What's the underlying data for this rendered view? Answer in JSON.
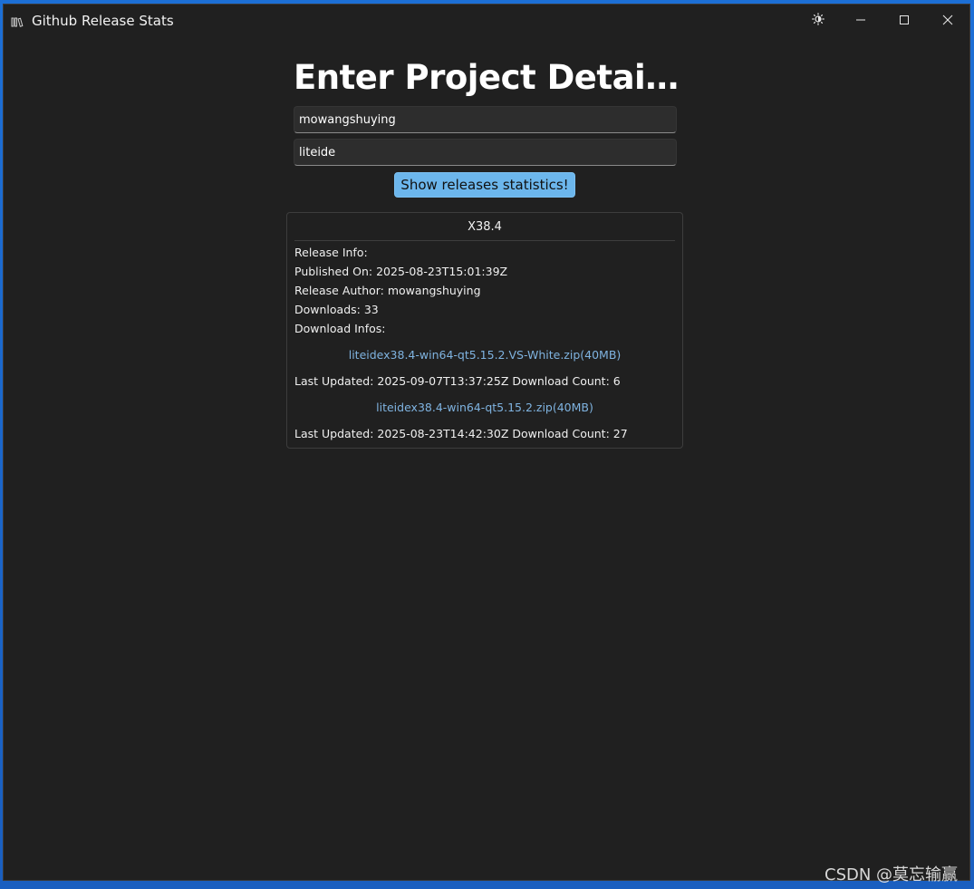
{
  "window": {
    "title": "Github Release Stats",
    "icon": "library-books-icon"
  },
  "caption_buttons": {
    "theme_icon": "brightness-icon",
    "minimize_icon": "minimize-icon",
    "maximize_icon": "maximize-icon",
    "close_icon": "close-icon"
  },
  "form": {
    "heading": "Enter Project Detail...",
    "owner_value": "mowangshuying",
    "repo_value": "liteide",
    "submit_label": "Show releases statistics!"
  },
  "release": {
    "tag": "X38.4",
    "release_info_label": "Release Info:",
    "published_on": "Published On: 2025-08-23T15:01:39Z",
    "author": "Release Author: mowangshuying",
    "downloads": "Downloads: 33",
    "download_infos_label": "Download Infos:",
    "assets": [
      {
        "name": "liteidex38.4-win64-qt5.15.2.VS-White.zip(40MB)",
        "meta": "Last Updated: 2025-09-07T13:37:25Z Download Count: 6"
      },
      {
        "name": "liteidex38.4-win64-qt5.15.2.zip(40MB)",
        "meta": "Last Updated: 2025-08-23T14:42:30Z Download Count: 27"
      }
    ]
  },
  "watermark": "CSDN @莫忘输赢",
  "colors": {
    "accent": "#6cb6ec",
    "link": "#7fb3e0",
    "background": "#202020"
  }
}
